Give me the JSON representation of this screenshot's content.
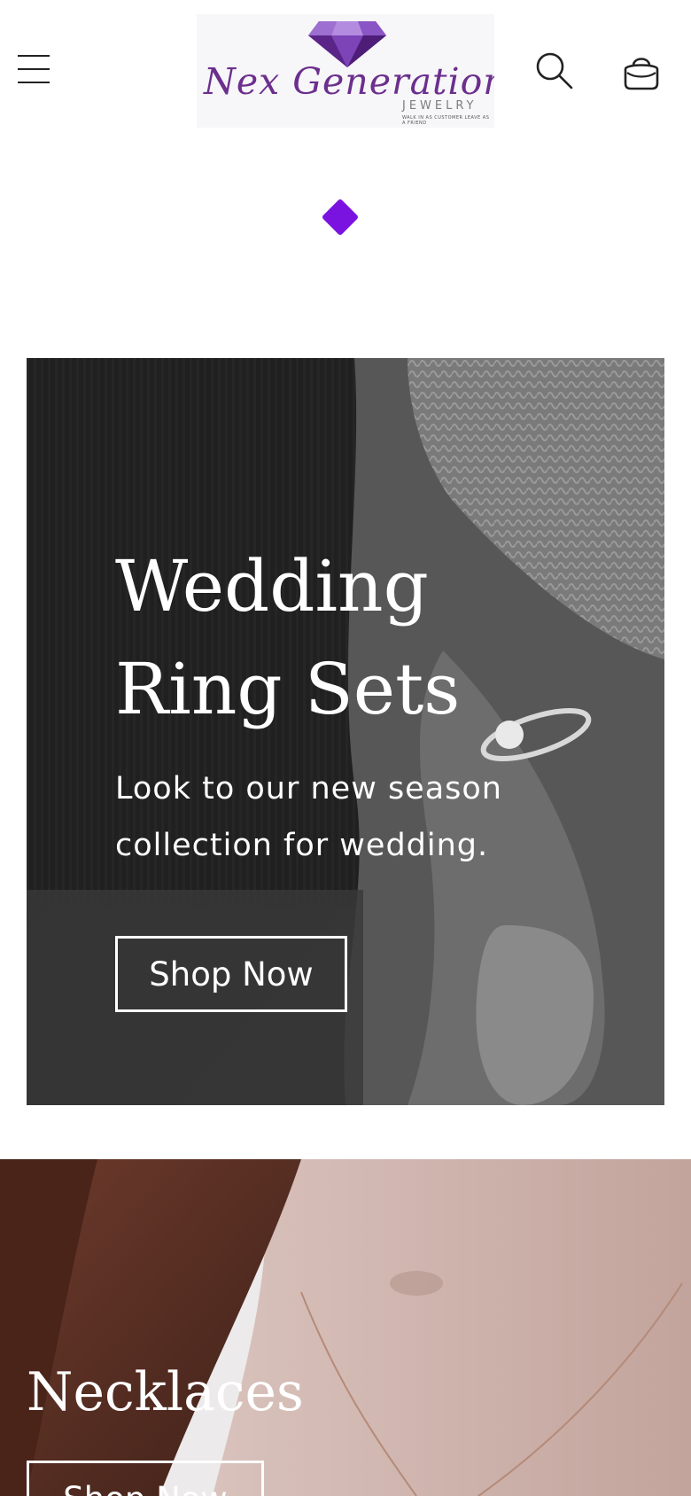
{
  "header": {
    "logo": {
      "brand": "Nex Generation",
      "sub": "JEWELRY",
      "tagline": "WALK IN AS CUSTOMER LEAVE AS A FRIEND"
    },
    "icons": {
      "menu": "hamburger-menu-icon",
      "search": "search-icon",
      "cart": "cart-bag-icon"
    }
  },
  "accent_color": "#7b13e0",
  "hero": {
    "title_line1": "Wedding",
    "title_line2": "Ring Sets",
    "subtitle_line1": "Look to our new season",
    "subtitle_line2": "collection for wedding.",
    "button_label": "Shop Now"
  },
  "section2": {
    "title": "Necklaces",
    "button_label": "Shop Now"
  }
}
